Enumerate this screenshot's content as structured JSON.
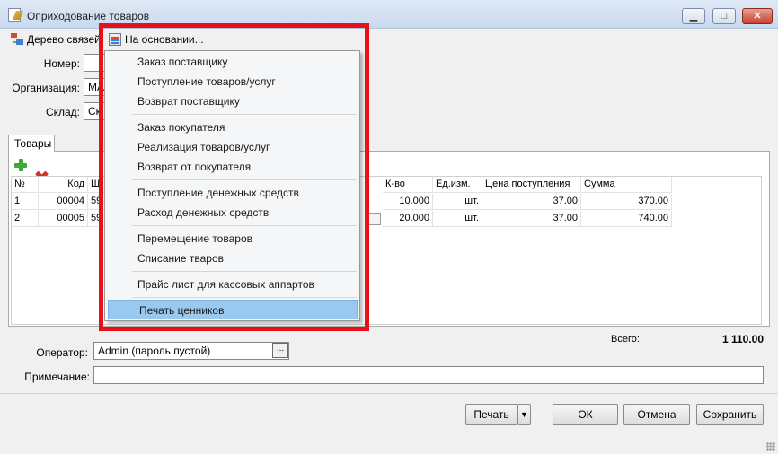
{
  "window": {
    "title": "Оприходование товаров",
    "minimize_glyph": "▁",
    "maximize_glyph": "□",
    "close_glyph": "✕"
  },
  "toolbar": {
    "relations_tree": "Дерево связей",
    "based_on": "На основании..."
  },
  "form": {
    "number_label": "Номер:",
    "number_value": "",
    "organization_label": "Организация:",
    "organization_value": "МА",
    "warehouse_label": "Склад:",
    "warehouse_value": "Ск"
  },
  "tabs": [
    {
      "label": "Товары"
    }
  ],
  "table": {
    "columns": [
      "№",
      "Код",
      "Ш",
      "К-во",
      "Ед.изм.",
      "Цена поступления",
      "Сумма"
    ],
    "rows": [
      {
        "num": "1",
        "code": "00004",
        "barcode": "59",
        "qty": "10.000",
        "unit": "шт.",
        "price": "37.00",
        "sum": "370.00"
      },
      {
        "num": "2",
        "code": "00005",
        "barcode": "59",
        "qty": "20.000",
        "unit": "шт.",
        "price": "37.00",
        "sum": "740.00"
      }
    ]
  },
  "dropdown": {
    "items": [
      "Заказ поставщику",
      "Поступление товаров/услуг",
      "Возврат поставщику",
      "Заказ покупателя",
      "Реализация товаров/услуг",
      "Возврат от покупателя",
      "Поступление денежных средств",
      "Расход денежных средств",
      "Перемещение товаров",
      "Списание тваров",
      "Прайс лист для кассовых аппартов",
      "Печать ценников"
    ],
    "selected": "Печать ценников"
  },
  "footer": {
    "total_label": "Всего:",
    "total_value": "1 110.00",
    "operator_label": "Оператор:",
    "operator_value": "Admin (пароль пустой)",
    "operator_button": "...",
    "note_label": "Примечание:",
    "note_value": ""
  },
  "buttons": {
    "print": "Печать",
    "print_arrow": "▼",
    "ok": "ОК",
    "cancel": "Отмена",
    "save": "Сохранить"
  },
  "colors": {
    "highlight_frame": "#e8111a",
    "menu_selected": "#99c9ef"
  }
}
